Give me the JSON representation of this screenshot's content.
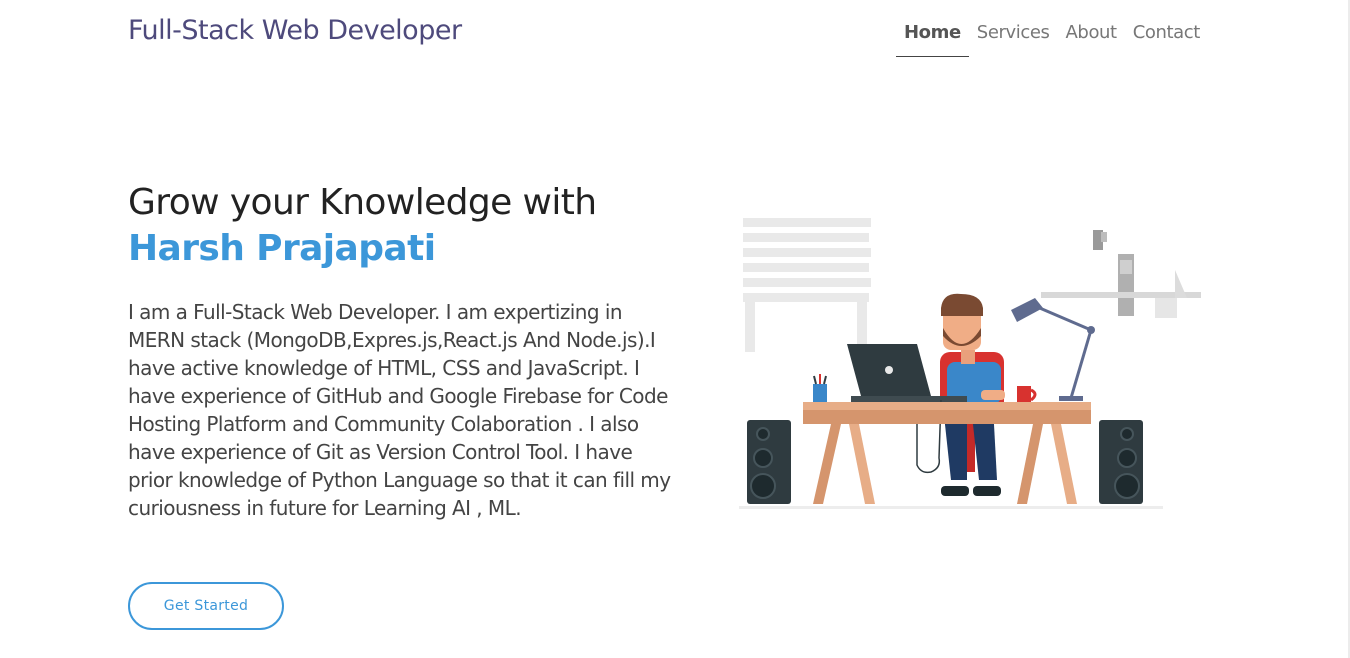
{
  "header": {
    "brand": "Full-Stack Web Developer",
    "nav": [
      {
        "label": "Home",
        "active": true
      },
      {
        "label": "Services",
        "active": false
      },
      {
        "label": "About",
        "active": false
      },
      {
        "label": "Contact",
        "active": false
      }
    ]
  },
  "hero": {
    "title": "Grow your Knowledge with",
    "name": "Harsh Prajapati",
    "description": "I am a Full-Stack Web Developer. I am expertizing in MERN stack (MongoDB,Expres.js,React.js And Node.js).I have active knowledge of HTML, CSS and JavaScript. I have experience of GitHub and Google Firebase for Code Hosting Platform and Community Colaboration . I also have experience of Git as Version Control Tool. I have prior knowledge of Python Language so that it can fill my curiousness in future for Learning AI , ML.",
    "cta_label": "Get Started"
  },
  "colors": {
    "brand": "#4e4a7c",
    "accent": "#3c97d9",
    "text": "#444444"
  },
  "illustration": {
    "icon": "developer-at-desk-illustration"
  }
}
